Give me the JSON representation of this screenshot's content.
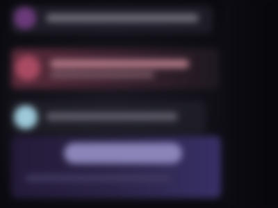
{
  "screen": {
    "state": "blurred",
    "rows": [
      {
        "id": "row-1",
        "text": ""
      },
      {
        "id": "row-2",
        "text": ""
      },
      {
        "id": "row-3",
        "text": ""
      },
      {
        "id": "row-4",
        "text": ""
      }
    ]
  },
  "colors": {
    "background": "#0e0d14",
    "highlight_row": "#5a2a3a",
    "highlight_avatar": "#a84a62",
    "secondary_avatar": "#9cc8d8",
    "accent_panel": "#383066",
    "accent_pill": "#8a84b8"
  }
}
